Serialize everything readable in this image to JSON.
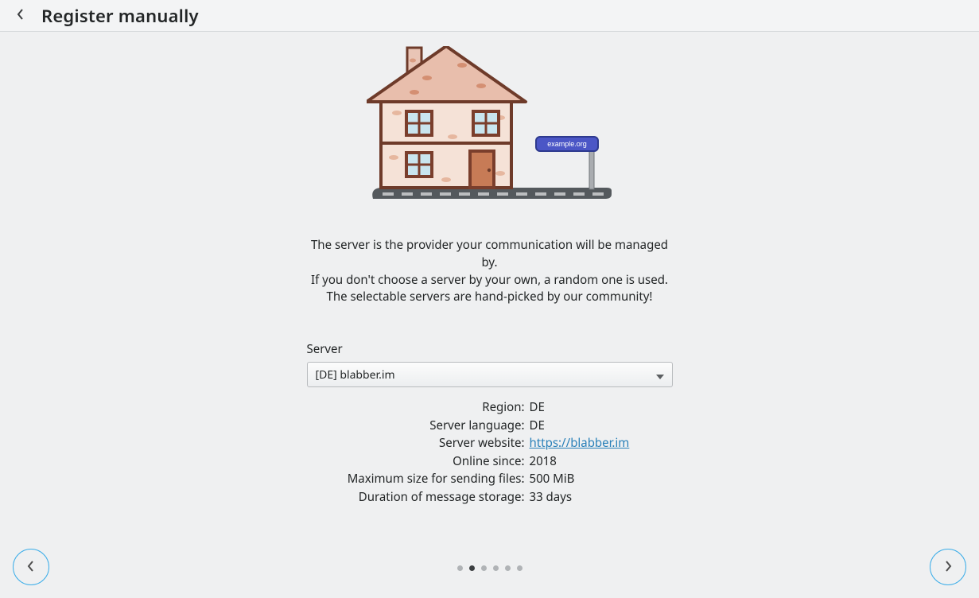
{
  "header": {
    "title": "Register manually"
  },
  "illustration": {
    "sign_text": "example.org"
  },
  "description": {
    "line1": "The server is the provider your communication will be managed by.",
    "line2": "If you don't choose a server by your own, a random one is used.",
    "line3": "The selectable servers are hand-picked by our community!"
  },
  "server": {
    "label": "Server",
    "selected": "[DE] blabber.im"
  },
  "details": {
    "region_label": "Region:",
    "region_value": "DE",
    "language_label": "Server language:",
    "language_value": "DE",
    "website_label": "Server website:",
    "website_url": "https://blabber.im",
    "online_since_label": "Online since:",
    "online_since_value": "2018",
    "max_file_label": "Maximum size for sending files:",
    "max_file_value": "500 MiB",
    "storage_label": "Duration of message storage:",
    "storage_value": "33 days"
  },
  "pager": {
    "total": 6,
    "active_index": 1
  }
}
